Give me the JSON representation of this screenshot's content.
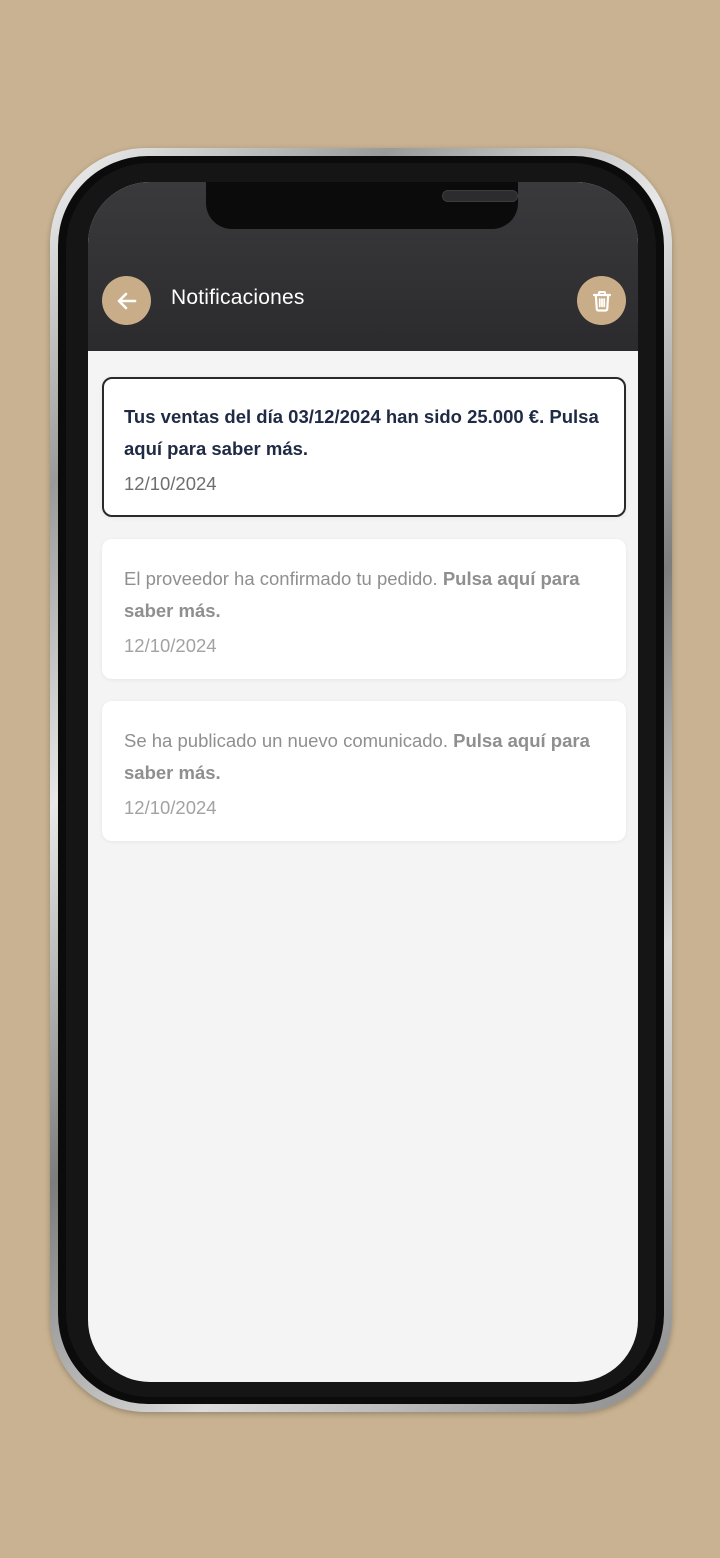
{
  "header": {
    "title": "Notificaciones",
    "back_icon": "arrow-left-icon",
    "delete_icon": "trash-icon"
  },
  "colors": {
    "background": "#c8b291",
    "accent": "#c9ad88",
    "header": "#2f2f32",
    "unread_text": "#1f2a44",
    "read_text": "#8f8f8f"
  },
  "notifications": [
    {
      "text": "Tus ventas del día 03/12/2024 han sido 25.000 €.",
      "cta": "Pulsa aquí para saber más.",
      "date": "12/10/2024",
      "unread": true
    },
    {
      "text": "El proveedor ha confirmado tu pedido.",
      "cta": "Pulsa aquí para saber más.",
      "date": "12/10/2024",
      "unread": false
    },
    {
      "text": "Se ha publicado un nuevo comunicado.",
      "cta": "Pulsa aquí para saber más.",
      "date": "12/10/2024",
      "unread": false
    }
  ]
}
